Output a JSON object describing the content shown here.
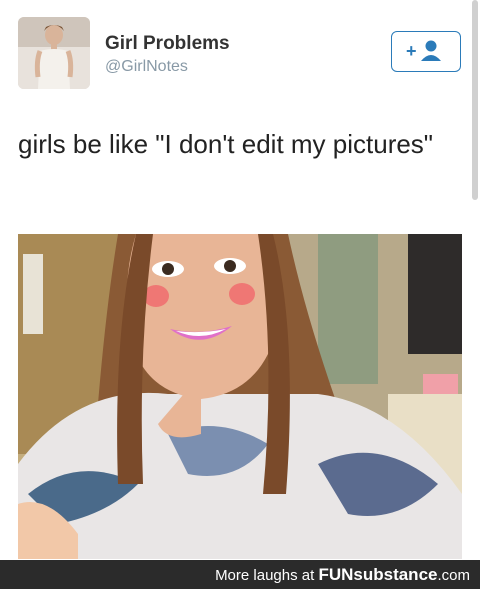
{
  "profile": {
    "name": "Girl Problems",
    "handle": "@GirlNotes",
    "follow_icon": "add-user-icon"
  },
  "tweet": {
    "text": "girls be like \"I don't edit my pictures\""
  },
  "footer": {
    "prefix": "More laughs at ",
    "brand": "FUNsubstance",
    "suffix": ".com"
  },
  "colors": {
    "accent": "#2b7bb9",
    "footer_bg": "#2b2b2b"
  }
}
